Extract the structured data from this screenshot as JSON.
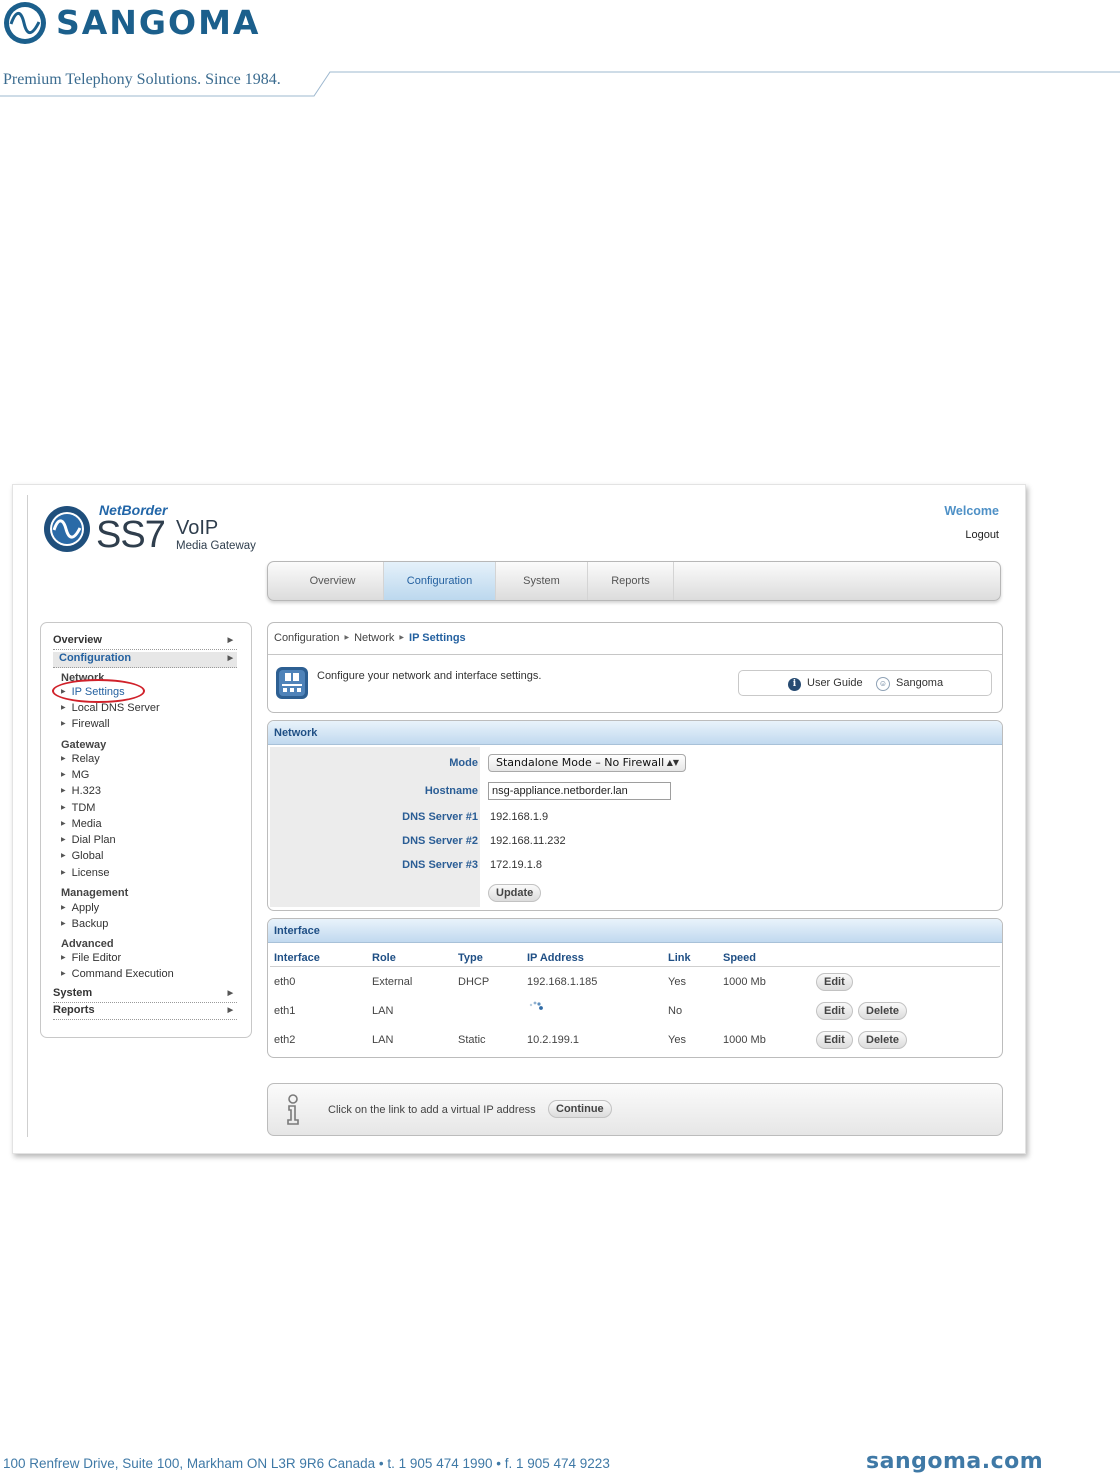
{
  "document": {
    "brand": "SANGOMA",
    "tagline": "Premium Telephony Solutions. Since 1984.",
    "footer_address": "100 Renfrew Drive, Suite 100, Markham ON L3R 9R6 Canada  •  t. 1 905 474 1990  •  f. 1 905 474 9223",
    "footer_site": "sangoma.com"
  },
  "app": {
    "brand_top": "NetBorder",
    "brand_main": "SS7",
    "brand_voip": "VoIP",
    "brand_sub": "Media Gateway",
    "welcome": "Welcome",
    "logout": "Logout"
  },
  "topnav": {
    "tabs": [
      {
        "label": "Overview"
      },
      {
        "label": "Configuration"
      },
      {
        "label": "System"
      },
      {
        "label": "Reports"
      }
    ]
  },
  "sidebar": {
    "overview": "Overview",
    "configuration": "Configuration",
    "network": "Network",
    "network_items": [
      "IP Settings",
      "Local DNS Server",
      "Firewall"
    ],
    "gateway": "Gateway",
    "gateway_items": [
      "Relay",
      "MG",
      "H.323",
      "TDM",
      "Media",
      "Dial Plan",
      "Global",
      "License"
    ],
    "management": "Management",
    "management_items": [
      "Apply",
      "Backup"
    ],
    "advanced": "Advanced",
    "advanced_items": [
      "File Editor",
      "Command Execution"
    ],
    "system": "System",
    "reports": "Reports"
  },
  "breadcrumb": [
    "Configuration",
    "Network",
    "IP Settings"
  ],
  "intro": {
    "text": "Configure your network and interface settings.",
    "user_guide": "User Guide",
    "sangoma_link": "Sangoma"
  },
  "network": {
    "title": "Network",
    "mode_label": "Mode",
    "mode_value": "Standalone Mode – No Firewall",
    "hostname_label": "Hostname",
    "hostname_value": "nsg-appliance.netborder.lan",
    "dns1_label": "DNS Server #1",
    "dns1_value": "192.168.1.9",
    "dns2_label": "DNS Server #2",
    "dns2_value": "192.168.11.232",
    "dns3_label": "DNS Server #3",
    "dns3_value": "172.19.1.8",
    "update_button": "Update"
  },
  "interface": {
    "title": "Interface",
    "columns": [
      "Interface",
      "Role",
      "Type",
      "IP Address",
      "Link",
      "Speed"
    ],
    "rows": [
      {
        "interface": "eth0",
        "role": "External",
        "type": "DHCP",
        "ip": "192.168.1.185",
        "link": "Yes",
        "speed": "1000 Mb",
        "edit": "Edit"
      },
      {
        "interface": "eth1",
        "role": "LAN",
        "type": "",
        "ip": "",
        "link": "No",
        "speed": "",
        "edit": "Edit",
        "delete": "Delete"
      },
      {
        "interface": "eth2",
        "role": "LAN",
        "type": "Static",
        "ip": "10.2.199.1",
        "link": "Yes",
        "speed": "1000 Mb",
        "edit": "Edit",
        "delete": "Delete"
      }
    ]
  },
  "virtual": {
    "text": "Click on the link to add a virtual IP address",
    "continue_button": "Continue"
  },
  "colors": {
    "brand_blue": "#1b5f8c",
    "link_blue": "#2461a0",
    "highlight_red": "#d0212a"
  }
}
